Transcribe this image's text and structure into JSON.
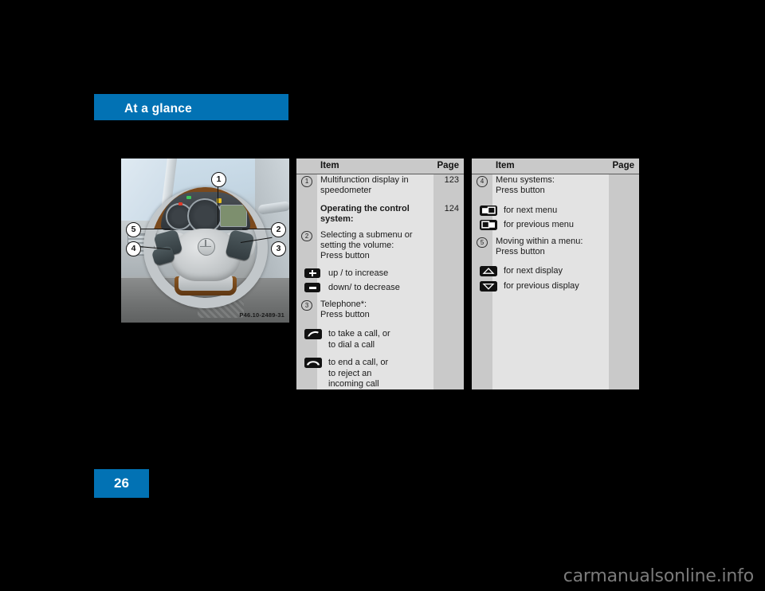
{
  "header": {
    "title": "At a glance"
  },
  "page": {
    "number": "26"
  },
  "figure": {
    "code": "P46.10-2489-31",
    "callouts": [
      "1",
      "2",
      "3",
      "4",
      "5"
    ]
  },
  "tables": [
    {
      "id": "left",
      "headers": {
        "item": "Item",
        "page": "Page"
      },
      "rows": [
        {
          "type": "entry",
          "num": "1",
          "text": "Multifunction display in speedometer",
          "page": "123"
        },
        {
          "type": "spacer"
        },
        {
          "type": "entry",
          "num": "",
          "text": "Operating the control system:",
          "bold": true,
          "page": "124"
        },
        {
          "type": "entry",
          "num": "2",
          "text": "Selecting a submenu or setting the volume:\nPress button",
          "page": ""
        },
        {
          "type": "icon",
          "icon": "plus-button-icon",
          "text": "up / to increase"
        },
        {
          "type": "icon",
          "icon": "minus-button-icon",
          "text": "down/ to decrease"
        },
        {
          "type": "entry",
          "num": "3",
          "text": "Telephone*:\nPress button",
          "page": ""
        },
        {
          "type": "icon",
          "icon": "phone-pickup-icon",
          "text": "to take a call, or to dial a call"
        },
        {
          "type": "icon",
          "icon": "phone-hangup-icon",
          "text": "to end a call, or to reject an incoming call"
        }
      ]
    },
    {
      "id": "right",
      "headers": {
        "item": "Item",
        "page": "Page"
      },
      "rows": [
        {
          "type": "entry",
          "num": "4",
          "text": "Menu systems:\nPress button",
          "page": ""
        },
        {
          "type": "icon",
          "icon": "next-menu-icon",
          "text": "for next menu"
        },
        {
          "type": "icon",
          "icon": "previous-menu-icon",
          "text": "for previous menu"
        },
        {
          "type": "entry",
          "num": "5",
          "text": "Moving within a menu:\nPress button",
          "page": ""
        },
        {
          "type": "icon",
          "icon": "up-arrow-icon",
          "text": "for next display"
        },
        {
          "type": "icon",
          "icon": "down-arrow-icon",
          "text": "for previous display"
        }
      ]
    }
  ],
  "watermark": {
    "text": "carmanualsonline.info"
  },
  "colors": {
    "accent_blue": "#0272b4",
    "table_bg": "#e3e3e3",
    "table_col_bg": "#c9c9c9",
    "page_bg": "#000000"
  }
}
